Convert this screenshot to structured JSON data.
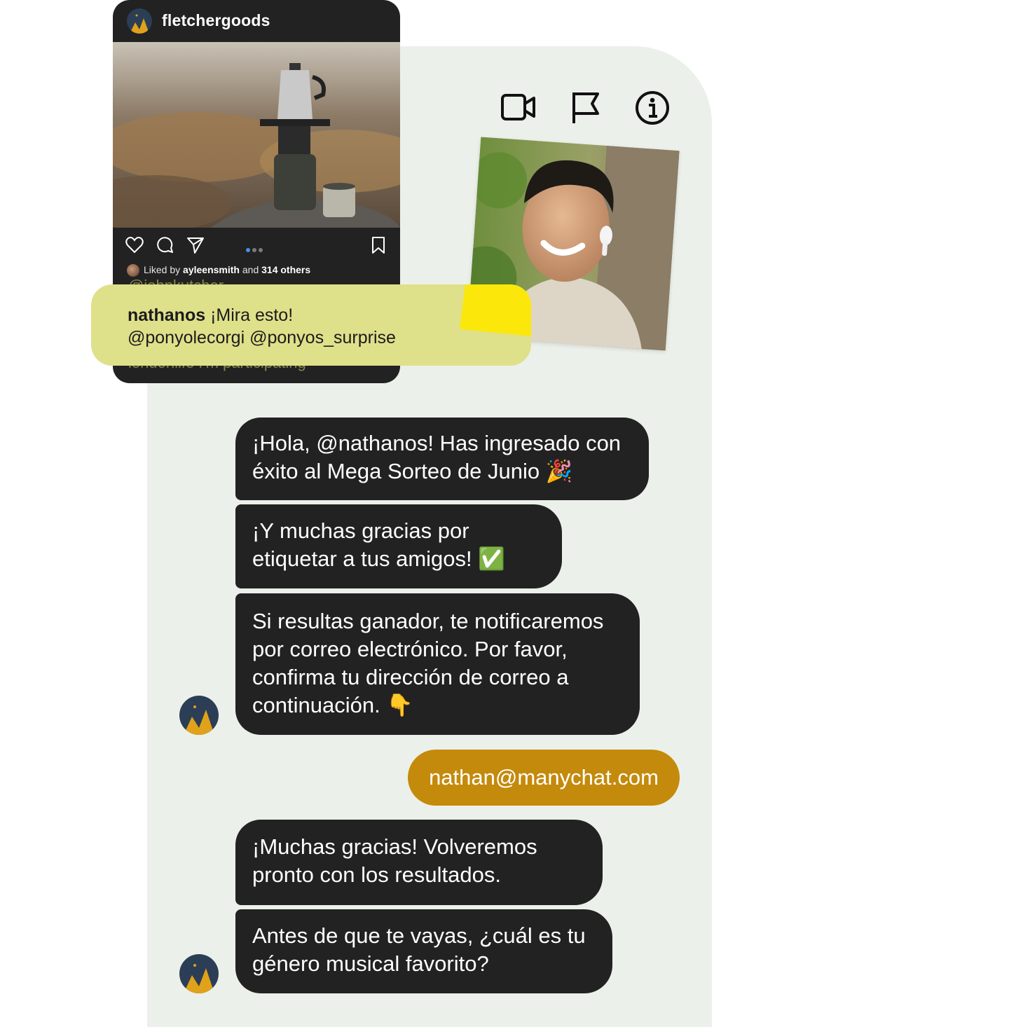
{
  "post": {
    "username": "fletchergoods",
    "liked_by_prefix": "Liked by",
    "liked_by_user": "ayleensmith",
    "liked_by_and": "and",
    "liked_by_others": "314 others",
    "ghost_comment_top": "@johnkutcher",
    "ghost_comment_bottom": "londonlife I'm participating"
  },
  "comment": {
    "user": "nathanos",
    "text": "¡Mira esto!",
    "mentions": "@ponyolecorgi @ponyos_surprise"
  },
  "top_actions": [
    "video-call-icon",
    "flag-icon",
    "info-icon"
  ],
  "messages": [
    {
      "from": "bot",
      "lines": [
        "¡Hola, @nathanos! Has ingresado con",
        "éxito al Mega Sorteo de Junio"
      ],
      "emoji": "🎉"
    },
    {
      "from": "bot",
      "lines": [
        "¡Y muchas gracias por",
        "etiquetar a tus amigos!"
      ],
      "emoji": "✅"
    },
    {
      "from": "bot",
      "lines": [
        "Si resultas ganador, te notificaremos",
        "por correo electrónico. Por favor,",
        "confirma tu dirección de correo a",
        "continuación."
      ],
      "emoji": "👇"
    },
    {
      "from": "user",
      "text": "nathan@manychat.com"
    },
    {
      "from": "bot",
      "lines": [
        "¡Muchas gracias! Volveremos",
        "pronto con los resultados."
      ]
    },
    {
      "from": "bot",
      "lines": [
        "Antes de que te vayas, ¿cuál es tu",
        "género musical favorito?"
      ]
    }
  ],
  "colors": {
    "background": "#ecf0ea",
    "bot_bubble": "#222222",
    "user_bubble": "#c48a0c",
    "comment_bubble": "#dfe08a",
    "accent_yellow": "#fbe80a"
  }
}
